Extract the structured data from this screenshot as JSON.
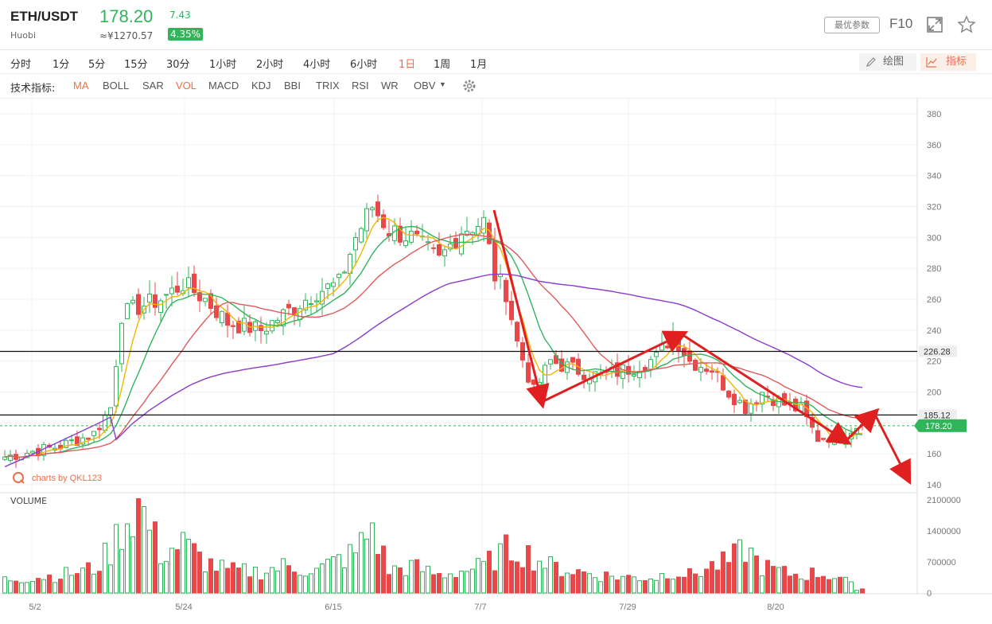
{
  "header": {
    "pair": "ETH/USDT",
    "exchange": "Huobi",
    "price": "178.20",
    "price_cny": "≈¥1270.57",
    "change": "7.43",
    "change_pct": "4.35%",
    "best_params": "最优参数",
    "f10": "F10"
  },
  "periods": [
    "分时",
    "1分",
    "5分",
    "15分",
    "30分",
    "1小时",
    "2小时",
    "4小时",
    "6小时",
    "1日",
    "1周",
    "1月"
  ],
  "active_period": "1日",
  "tools": {
    "draw": "绘图",
    "indicator": "指标"
  },
  "indicators": {
    "label": "技术指标:",
    "items": [
      "MA",
      "BOLL",
      "SAR",
      "VOL",
      "MACD",
      "KDJ",
      "BBI",
      "TRIX",
      "RSI",
      "WR",
      "OBV"
    ],
    "active": [
      "MA",
      "VOL"
    ]
  },
  "colors": {
    "up": "#2fb55a",
    "down": "#e8484a",
    "accent": "#e8704a"
  },
  "chart_data": {
    "type": "candlestick",
    "price_axis": {
      "ticks": [
        380,
        360,
        340,
        320,
        300,
        280,
        260,
        240,
        220,
        200,
        180,
        160,
        140
      ],
      "range": [
        138,
        385
      ]
    },
    "volume_axis": {
      "label": "VOLUME",
      "ticks": [
        "2100000",
        "1400000",
        "700000",
        "0"
      ],
      "range": [
        0,
        2100000
      ]
    },
    "x_labels": [
      "5/2",
      "5/24",
      "6/15",
      "7/7",
      "7/29",
      "8/20"
    ],
    "levels": [
      {
        "label": "226.28",
        "value": 226.28
      },
      {
        "label": "185.12",
        "value": 185.12
      }
    ],
    "last_price": {
      "label": "178.20",
      "value": 178.2
    },
    "watermark": "charts by QKL123",
    "close_anchors": [
      [
        0,
        158
      ],
      [
        10,
        165
      ],
      [
        16,
        173
      ],
      [
        19,
        190
      ],
      [
        21,
        250
      ],
      [
        24,
        255
      ],
      [
        28,
        260
      ],
      [
        32,
        270
      ],
      [
        36,
        260
      ],
      [
        40,
        245
      ],
      [
        46,
        240
      ],
      [
        50,
        250
      ],
      [
        56,
        265
      ],
      [
        60,
        270
      ],
      [
        63,
        300
      ],
      [
        66,
        320
      ],
      [
        69,
        305
      ],
      [
        73,
        300
      ],
      [
        78,
        285
      ],
      [
        82,
        305
      ],
      [
        86,
        310
      ],
      [
        88,
        275
      ],
      [
        90,
        265
      ],
      [
        92,
        232
      ],
      [
        95,
        200
      ],
      [
        98,
        220
      ],
      [
        102,
        215
      ],
      [
        107,
        210
      ],
      [
        112,
        215
      ],
      [
        117,
        222
      ],
      [
        120,
        238
      ],
      [
        123,
        220
      ],
      [
        127,
        215
      ],
      [
        130,
        200
      ],
      [
        133,
        190
      ],
      [
        136,
        200
      ],
      [
        140,
        192
      ],
      [
        143,
        188
      ],
      [
        146,
        170
      ],
      [
        150,
        172
      ],
      [
        153,
        178.2
      ]
    ],
    "volume_anchors": [
      [
        0,
        300
      ],
      [
        10,
        400
      ],
      [
        16,
        550
      ],
      [
        19,
        950
      ],
      [
        21,
        1500
      ],
      [
        24,
        2000
      ],
      [
        26,
        1500
      ],
      [
        28,
        900
      ],
      [
        32,
        1100
      ],
      [
        36,
        700
      ],
      [
        40,
        500
      ],
      [
        46,
        480
      ],
      [
        50,
        600
      ],
      [
        56,
        500
      ],
      [
        60,
        750
      ],
      [
        63,
        900
      ],
      [
        66,
        1500
      ],
      [
        69,
        500
      ],
      [
        73,
        600
      ],
      [
        78,
        400
      ],
      [
        82,
        500
      ],
      [
        86,
        600
      ],
      [
        88,
        800
      ],
      [
        90,
        950
      ],
      [
        92,
        1000
      ],
      [
        95,
        800
      ],
      [
        98,
        600
      ],
      [
        102,
        500
      ],
      [
        107,
        400
      ],
      [
        112,
        350
      ],
      [
        117,
        350
      ],
      [
        120,
        500
      ],
      [
        123,
        400
      ],
      [
        127,
        600
      ],
      [
        130,
        700
      ],
      [
        133,
        1000
      ],
      [
        136,
        600
      ],
      [
        140,
        450
      ],
      [
        143,
        400
      ],
      [
        146,
        450
      ],
      [
        150,
        350
      ],
      [
        153,
        100
      ]
    ],
    "ma": [
      {
        "period": 5,
        "color": "#f5b400"
      },
      {
        "period": 10,
        "color": "#2fb55a"
      },
      {
        "period": 20,
        "color": "#e05a5a"
      },
      {
        "period": 60,
        "color": "#8a3ccf"
      }
    ],
    "annotation_path": [
      [
        0,
        "top"
      ],
      [
        9,
        "bottom"
      ],
      [
        30,
        "bottom"
      ],
      [
        47,
        "top"
      ],
      [
        75,
        "bottom"
      ],
      [
        80,
        "bottom"
      ],
      [
        87,
        "bottom"
      ],
      [
        150,
        "top"
      ]
    ]
  }
}
